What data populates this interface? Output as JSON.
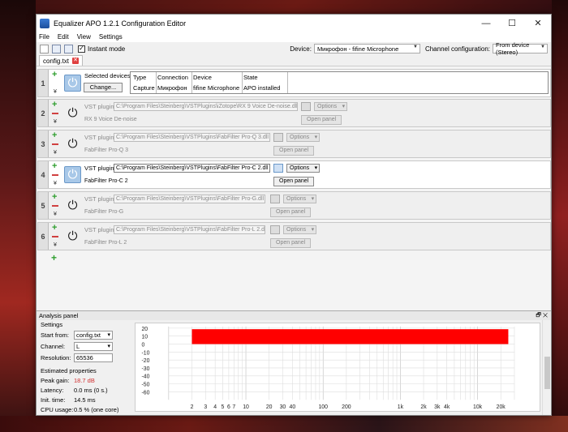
{
  "window": {
    "title": "Equalizer APO 1.2.1 Configuration Editor",
    "controls": {
      "minimize": "—",
      "maximize": "☐",
      "close": "✕"
    }
  },
  "menu": [
    "File",
    "Edit",
    "View",
    "Settings"
  ],
  "toolbar": {
    "instant_mode_label": "Instant mode",
    "instant_mode_checked": "✓",
    "device_label": "Device:",
    "device_value": "Микрофон - fifine Microphone",
    "channel_config_label": "Channel configuration:",
    "channel_config_value": "From device (Stereo)"
  },
  "tabs": [
    {
      "label": "config.txt",
      "close": "✕"
    }
  ],
  "rows": {
    "r1": {
      "num": "1",
      "selected_devices_label": "Selected devices:",
      "change_label": "Change...",
      "headers": [
        "Type",
        "Connection",
        "Device",
        "State"
      ],
      "values": [
        "Capture",
        "Микрофон",
        "fifine Microphone",
        "APO installed"
      ]
    },
    "r2": {
      "num": "2",
      "plugin_label": "VST plugin:",
      "path": "C:\\Program Files\\Steinberg\\VSTPlugins\\iZotope\\RX 9 Voice De-noise.dll",
      "options": "Options",
      "open_panel": "Open panel",
      "name": "RX 9 Voice De-noise"
    },
    "r3": {
      "num": "3",
      "plugin_label": "VST plugin:",
      "path": "C:\\Program Files\\Steinberg\\VSTPlugins\\FabFilter Pro-Q 3.dll",
      "options": "Options",
      "open_panel": "Open panel",
      "name": "FabFilter Pro-Q 3"
    },
    "r4": {
      "num": "4",
      "plugin_label": "VST plugin:",
      "path": "C:\\Program Files\\Steinberg\\VSTPlugins\\FabFilter Pro-C 2.dll",
      "options": "Options",
      "open_panel": "Open panel",
      "name": "FabFilter Pro-C 2"
    },
    "r5": {
      "num": "5",
      "plugin_label": "VST plugin:",
      "path": "C:\\Program Files\\Steinberg\\VSTPlugins\\FabFilter Pro-G.dll",
      "options": "Options",
      "open_panel": "Open panel",
      "name": "FabFilter Pro-G"
    },
    "r6": {
      "num": "6",
      "plugin_label": "VST plugin:",
      "path": "C:\\Program Files\\Steinberg\\VSTPlugins\\FabFilter Pro-L 2.dll",
      "options": "Options",
      "open_panel": "Open panel",
      "name": "FabFilter Pro-L 2"
    }
  },
  "analysis": {
    "panel_title": "Analysis panel",
    "panel_controls": "🗗 ✕",
    "settings_heading": "Settings",
    "start_from_label": "Start from:",
    "start_from_value": "config.txt",
    "channel_label": "Channel:",
    "channel_value": "L",
    "resolution_label": "Resolution:",
    "resolution_value": "65536",
    "estimated_heading": "Estimated properties",
    "peak_gain_label": "Peak gain:",
    "peak_gain_value": "18.7 dB",
    "latency_label": "Latency:",
    "latency_value": "0.0 ms (0 s.)",
    "init_time_label": "Init. time:",
    "init_time_value": "14.5 ms",
    "cpu_label": "CPU usage:",
    "cpu_value": "0.5 % (one core)"
  },
  "chart_data": {
    "type": "area",
    "x_scale": "log",
    "xlim": [
      1,
      30000
    ],
    "ylim": [
      -70,
      22
    ],
    "y_ticks": [
      20,
      10,
      0,
      -10,
      -20,
      -30,
      -40,
      -50,
      -60
    ],
    "x_ticks": [
      {
        "v": 2,
        "label": "2"
      },
      {
        "v": 3,
        "label": "3"
      },
      {
        "v": 4,
        "label": "4"
      },
      {
        "v": 5,
        "label": "5"
      },
      {
        "v": 6,
        "label": "6"
      },
      {
        "v": 7,
        "label": "7"
      },
      {
        "v": 10,
        "label": "10"
      },
      {
        "v": 20,
        "label": "20"
      },
      {
        "v": 30,
        "label": "30"
      },
      {
        "v": 40,
        "label": "40"
      },
      {
        "v": 100,
        "label": "100"
      },
      {
        "v": 200,
        "label": "200"
      },
      {
        "v": 1000,
        "label": "1k"
      },
      {
        "v": 2000,
        "label": "2k"
      },
      {
        "v": 3000,
        "label": "3k"
      },
      {
        "v": 4000,
        "label": "4k"
      },
      {
        "v": 10000,
        "label": "10k"
      },
      {
        "v": 20000,
        "label": "20k"
      }
    ],
    "band": {
      "x_from": 2,
      "x_to": 25000,
      "y_top": 18.7,
      "y_bottom": 0,
      "color": "#ff0000"
    }
  }
}
